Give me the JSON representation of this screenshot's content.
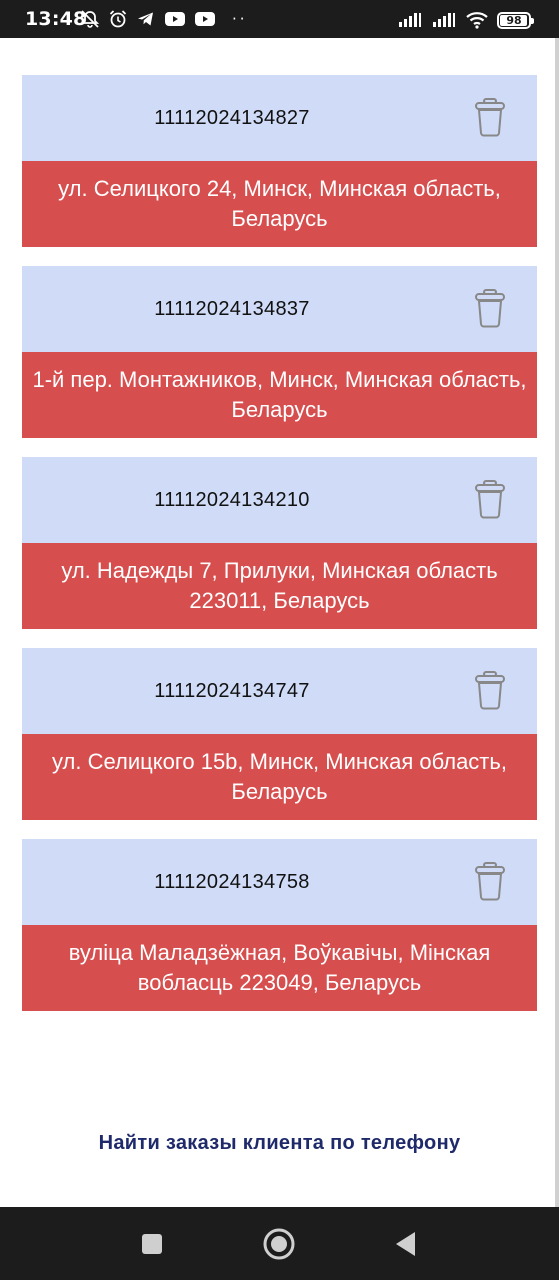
{
  "status_bar": {
    "time": "13:48",
    "left_icons": [
      "notifications-off-icon",
      "alarm-icon",
      "telegram-icon",
      "youtube-icon",
      "youtube-icon"
    ],
    "dots": "··",
    "right_icons": [
      "signal-icon",
      "signal-icon",
      "wifi-icon",
      "battery-icon"
    ],
    "battery_level": "98"
  },
  "orders": [
    {
      "id": "11112024134827",
      "address": "ул. Селицкого 24, Минск, Минская область, Беларусь"
    },
    {
      "id": "11112024134837",
      "address": "1-й пер. Монтажников, Минск, Минская область, Беларусь"
    },
    {
      "id": "11112024134210",
      "address": "ул. Надежды 7, Прилуки, Минская область 223011, Беларусь"
    },
    {
      "id": "11112024134747",
      "address": "ул. Селицкого 15b, Минск, Минская область, Беларусь"
    },
    {
      "id": "11112024134758",
      "address": "вуліца Маладзёжная, Воўкавічы, Мінская вобласць 223049, Беларусь"
    }
  ],
  "find_orders_link": "Найти заказы клиента по телефону",
  "colors": {
    "card_top": "#cfdbf7",
    "card_bottom": "#d74e4e",
    "link": "#1f2a6b",
    "system_bars": "#1c1c1c"
  },
  "nav_bar": {
    "buttons": [
      "recents-square-icon",
      "home-circle-icon",
      "back-triangle-icon"
    ]
  }
}
